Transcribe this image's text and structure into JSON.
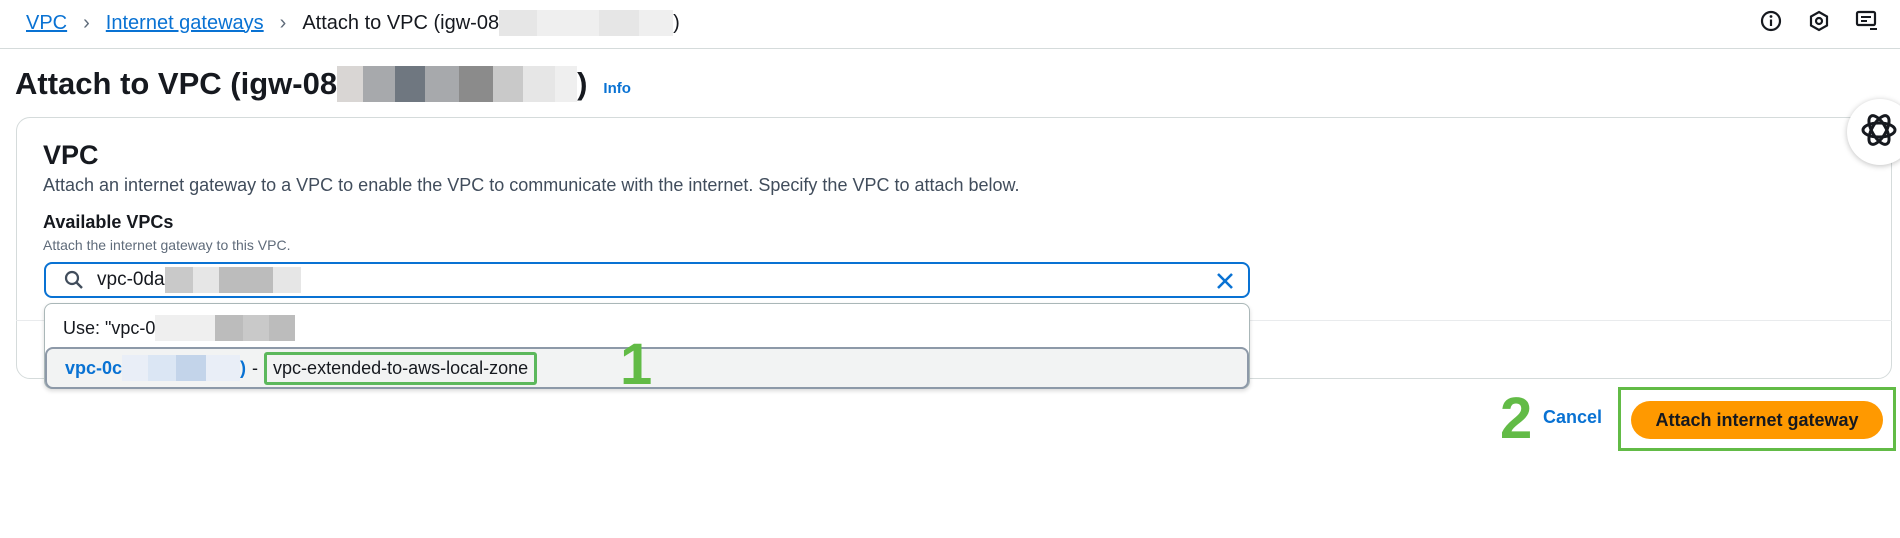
{
  "breadcrumb": {
    "items": [
      "VPC",
      "Internet gateways"
    ],
    "current_prefix": "Attach to VPC (igw-08",
    "current_suffix": ")"
  },
  "top_icons": [
    "info-icon",
    "settings-icon",
    "feedback-icon"
  ],
  "page": {
    "title_prefix": "Attach to VPC (igw-08",
    "title_suffix": ")",
    "info_label": "Info"
  },
  "section": {
    "title": "VPC",
    "description": "Attach an internet gateway to a VPC to enable the VPC to communicate with the internet. Specify the VPC to attach below.",
    "field_label": "Available VPCs",
    "field_description": "Attach the internet gateway to this VPC."
  },
  "search": {
    "value": "vpc-0da"
  },
  "dropdown": {
    "use_option_prefix": "Use: \"vpc-0",
    "vpc_option_id_prefix": "vpc-0c",
    "vpc_option_id_suffix": ")",
    "vpc_option_separator": "-",
    "vpc_option_name": "vpc-extended-to-aws-local-zone"
  },
  "callouts": {
    "one": "1",
    "two": "2"
  },
  "actions": {
    "cancel_label": "Cancel",
    "attach_label": "Attach internet gateway"
  },
  "colors": {
    "link": "#0972d3",
    "primary_button": "#ff9900",
    "highlight": "#62bb46"
  }
}
